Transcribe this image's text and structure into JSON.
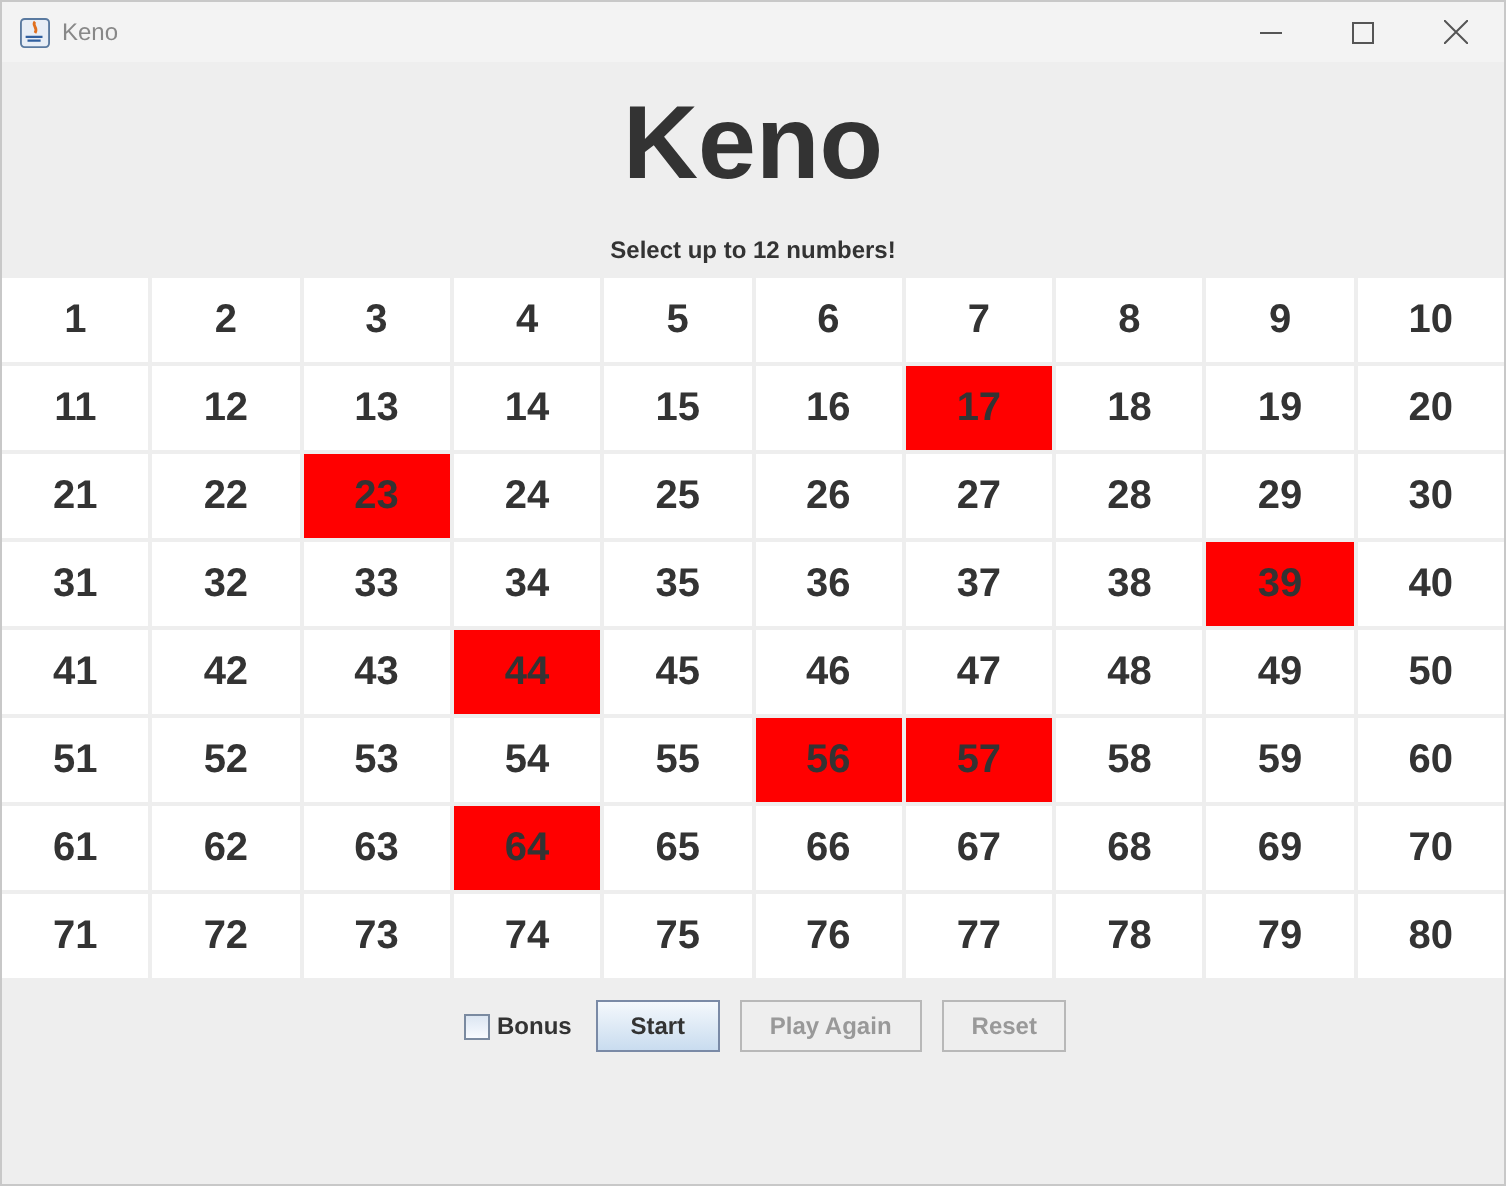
{
  "window": {
    "title": "Keno"
  },
  "heading": "Keno",
  "instruction": "Select up to 12 numbers!",
  "cells": [
    {
      "label": "1",
      "selected": false
    },
    {
      "label": "2",
      "selected": false
    },
    {
      "label": "3",
      "selected": false
    },
    {
      "label": "4",
      "selected": false
    },
    {
      "label": "5",
      "selected": false
    },
    {
      "label": "6",
      "selected": false
    },
    {
      "label": "7",
      "selected": false
    },
    {
      "label": "8",
      "selected": false
    },
    {
      "label": "9",
      "selected": false
    },
    {
      "label": "10",
      "selected": false
    },
    {
      "label": "11",
      "selected": false
    },
    {
      "label": "12",
      "selected": false
    },
    {
      "label": "13",
      "selected": false
    },
    {
      "label": "14",
      "selected": false
    },
    {
      "label": "15",
      "selected": false
    },
    {
      "label": "16",
      "selected": false
    },
    {
      "label": "17",
      "selected": true
    },
    {
      "label": "18",
      "selected": false
    },
    {
      "label": "19",
      "selected": false
    },
    {
      "label": "20",
      "selected": false
    },
    {
      "label": "21",
      "selected": false
    },
    {
      "label": "22",
      "selected": false
    },
    {
      "label": "23",
      "selected": true
    },
    {
      "label": "24",
      "selected": false
    },
    {
      "label": "25",
      "selected": false
    },
    {
      "label": "26",
      "selected": false
    },
    {
      "label": "27",
      "selected": false
    },
    {
      "label": "28",
      "selected": false
    },
    {
      "label": "29",
      "selected": false
    },
    {
      "label": "30",
      "selected": false
    },
    {
      "label": "31",
      "selected": false
    },
    {
      "label": "32",
      "selected": false
    },
    {
      "label": "33",
      "selected": false
    },
    {
      "label": "34",
      "selected": false
    },
    {
      "label": "35",
      "selected": false
    },
    {
      "label": "36",
      "selected": false
    },
    {
      "label": "37",
      "selected": false
    },
    {
      "label": "38",
      "selected": false
    },
    {
      "label": "39",
      "selected": true
    },
    {
      "label": "40",
      "selected": false
    },
    {
      "label": "41",
      "selected": false
    },
    {
      "label": "42",
      "selected": false
    },
    {
      "label": "43",
      "selected": false
    },
    {
      "label": "44",
      "selected": true
    },
    {
      "label": "45",
      "selected": false
    },
    {
      "label": "46",
      "selected": false
    },
    {
      "label": "47",
      "selected": false
    },
    {
      "label": "48",
      "selected": false
    },
    {
      "label": "49",
      "selected": false
    },
    {
      "label": "50",
      "selected": false
    },
    {
      "label": "51",
      "selected": false
    },
    {
      "label": "52",
      "selected": false
    },
    {
      "label": "53",
      "selected": false
    },
    {
      "label": "54",
      "selected": false
    },
    {
      "label": "55",
      "selected": false
    },
    {
      "label": "56",
      "selected": true
    },
    {
      "label": "57",
      "selected": true
    },
    {
      "label": "58",
      "selected": false
    },
    {
      "label": "59",
      "selected": false
    },
    {
      "label": "60",
      "selected": false
    },
    {
      "label": "61",
      "selected": false
    },
    {
      "label": "62",
      "selected": false
    },
    {
      "label": "63",
      "selected": false
    },
    {
      "label": "64",
      "selected": true
    },
    {
      "label": "65",
      "selected": false
    },
    {
      "label": "66",
      "selected": false
    },
    {
      "label": "67",
      "selected": false
    },
    {
      "label": "68",
      "selected": false
    },
    {
      "label": "69",
      "selected": false
    },
    {
      "label": "70",
      "selected": false
    },
    {
      "label": "71",
      "selected": false
    },
    {
      "label": "72",
      "selected": false
    },
    {
      "label": "73",
      "selected": false
    },
    {
      "label": "74",
      "selected": false
    },
    {
      "label": "75",
      "selected": false
    },
    {
      "label": "76",
      "selected": false
    },
    {
      "label": "77",
      "selected": false
    },
    {
      "label": "78",
      "selected": false
    },
    {
      "label": "79",
      "selected": false
    },
    {
      "label": "80",
      "selected": false
    }
  ],
  "bonus": {
    "label": "Bonus",
    "checked": false
  },
  "buttons": [
    {
      "label": "Start",
      "disabled": false
    },
    {
      "label": "Play Again",
      "disabled": true
    },
    {
      "label": "Reset",
      "disabled": true
    }
  ]
}
